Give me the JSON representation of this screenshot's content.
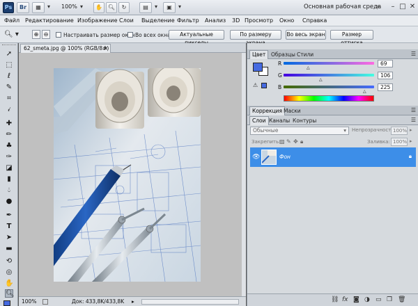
{
  "appbar": {
    "ps_logo": "Ps",
    "br_logo": "Br",
    "zoom": "100%",
    "workspace": "Основная рабочая среда",
    "buttons": [
      "▦",
      "▼",
      "✋",
      "🔍",
      "↻",
      "▦",
      "▦"
    ],
    "win_min": "–",
    "win_max": "□",
    "win_close": "✕"
  },
  "menubar": {
    "items": [
      "Файл",
      "Редактирование",
      "Изображение",
      "Слои",
      "Выделение",
      "Фильтр",
      "Анализ",
      "3D",
      "Просмотр",
      "Окно",
      "Справка"
    ]
  },
  "options": {
    "resize_windows": "Настраивать размер окон",
    "all_windows": "Во всех окнах",
    "actual_pixels": "Актуальные пикселы",
    "fit_screen": "По размеру экрана",
    "fill_screen": "Во весь экран",
    "print_size": "Размер оттиска"
  },
  "document": {
    "tab_title": "62_smeta.jpg @ 100% (RGB/8#)",
    "tab_close": "✕",
    "status_zoom": "100%",
    "status_doc": "Док: 433,8K/433,8K"
  },
  "color_panel": {
    "tabs": [
      "Цвет",
      "Образцы",
      "Стили"
    ],
    "channels": [
      {
        "label": "R",
        "value": "69"
      },
      {
        "label": "G",
        "value": "106"
      },
      {
        "label": "B",
        "value": "225"
      }
    ],
    "fg_color": "#456ae1",
    "bg_color": "#ffffff"
  },
  "adjust_panel": {
    "tabs": [
      "Коррекция",
      "Маски"
    ]
  },
  "layers_panel": {
    "tabs": [
      "Слои",
      "Каналы",
      "Контуры"
    ],
    "blend_mode": "Обычные",
    "opacity_label": "Непрозрачность:",
    "opacity_value": "100%",
    "lock_label": "Закрепить:",
    "fill_label": "Заливка:",
    "fill_value": "100%",
    "layers": [
      {
        "name": "Фон"
      }
    ],
    "accent": "#3d8ee8"
  }
}
